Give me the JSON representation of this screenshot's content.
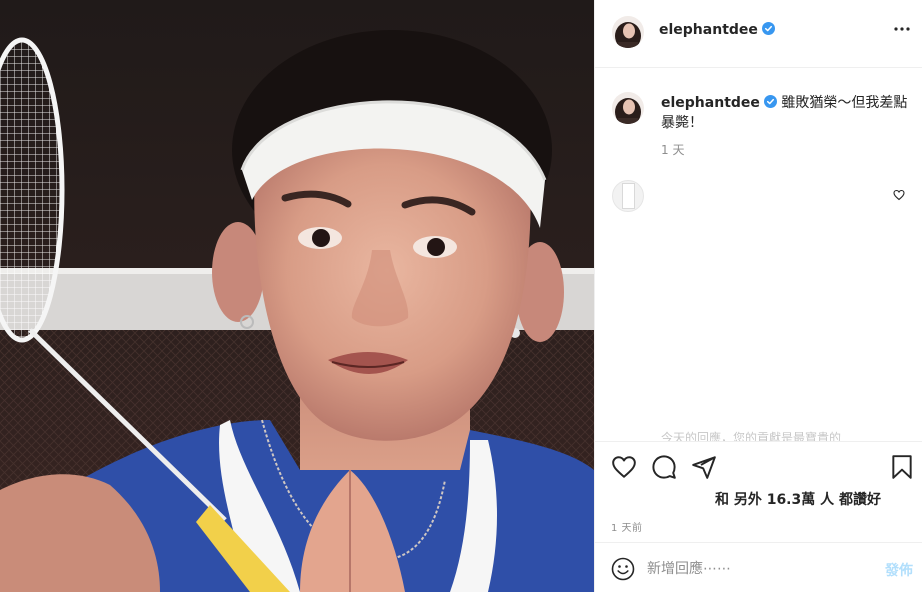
{
  "post": {
    "image_alt": "",
    "author": {
      "username": "elephantdee",
      "verified": true
    }
  },
  "header": {
    "username": "elephantdee",
    "more_icon": "more-horizontal-icon"
  },
  "caption": {
    "username": "elephantdee",
    "text": "雖敗猶榮～但我差點暴斃！",
    "time": "1 天"
  },
  "comments": [
    {
      "avatar": "blank-avatar",
      "liked": false
    }
  ],
  "faded_text": "今天的回應，您的貢獻是最寶貴的",
  "actions": {
    "icons": [
      "heart-icon",
      "comment-icon",
      "share-icon",
      "bookmark-icon"
    ],
    "likes_text": "和 另外 16.3萬 人 都讚好",
    "post_time": "1 天前"
  },
  "add_comment": {
    "placeholder": "新增回應⋯⋯",
    "post_label": "發佈"
  },
  "colors": {
    "jersey": "#2f4fa8",
    "headband": "#f3f3f1",
    "verified": "#3897f0",
    "post_button": "#b2dffc"
  }
}
